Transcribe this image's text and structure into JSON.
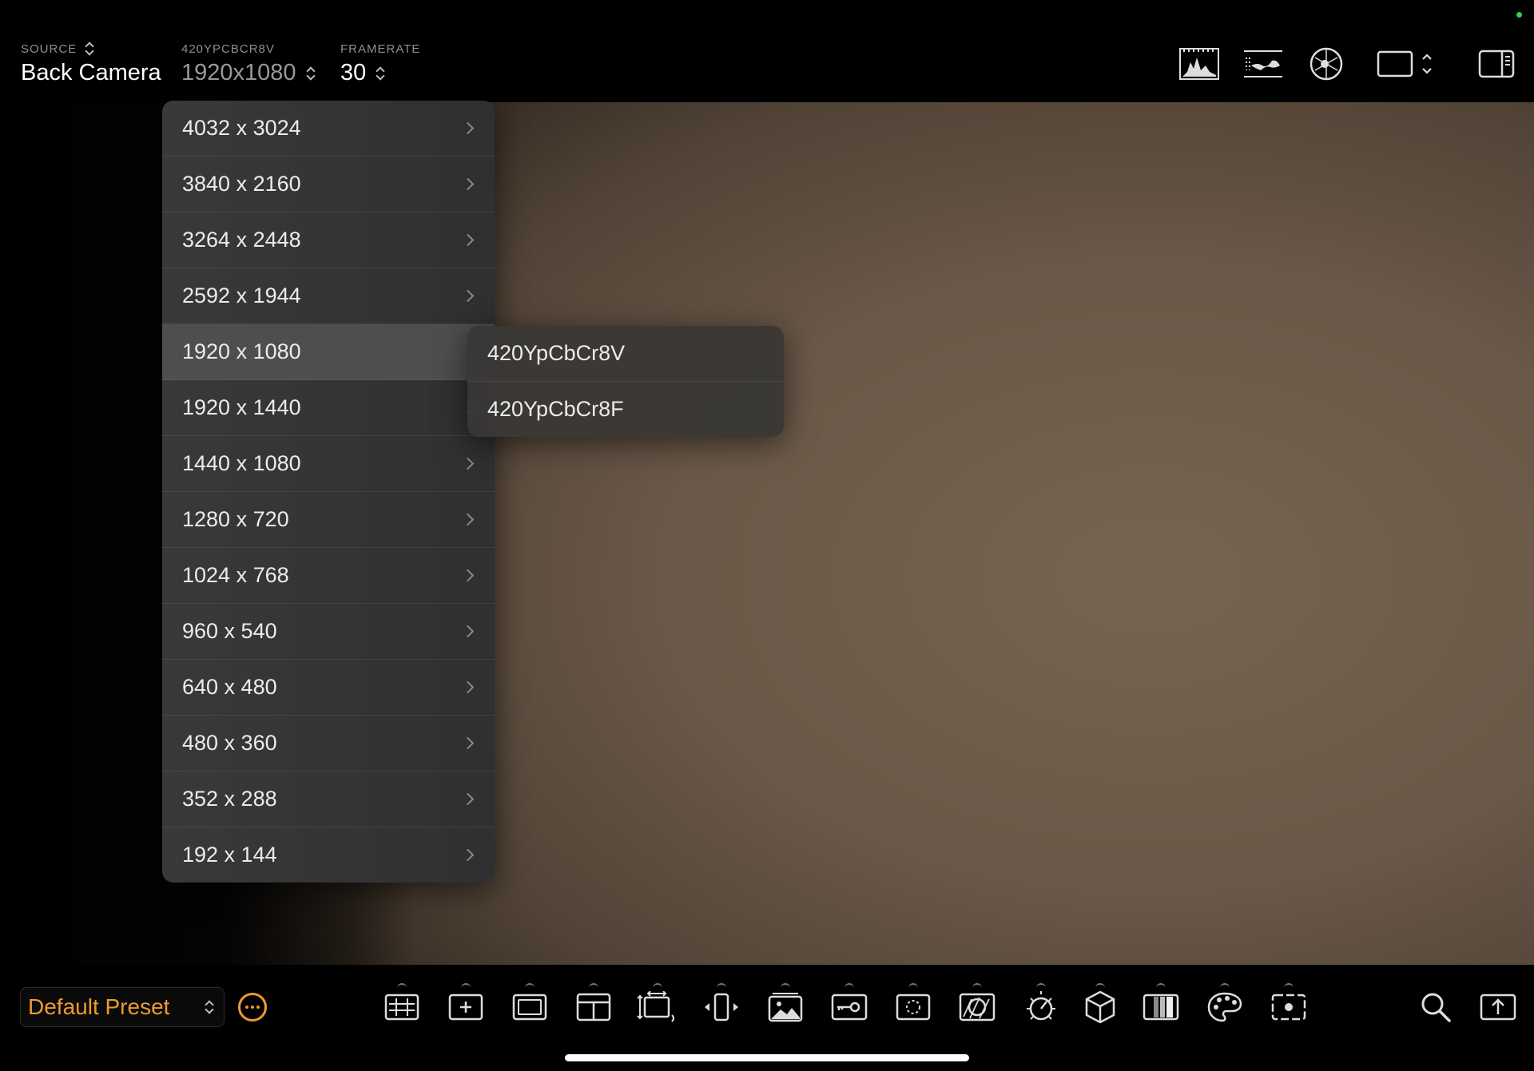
{
  "top": {
    "source_label": "SOURCE",
    "source_value": "Back Camera",
    "format_label": "420YPCBCR8V",
    "format_value": "1920x1080",
    "framerate_label": "FRAMERATE",
    "framerate_value": "30"
  },
  "resolution_menu": {
    "items": [
      {
        "label": "4032 x 3024"
      },
      {
        "label": "3840 x 2160"
      },
      {
        "label": "3264 x 2448"
      },
      {
        "label": "2592 x 1944"
      },
      {
        "label": "1920 x 1080"
      },
      {
        "label": "1920 x 1440"
      },
      {
        "label": "1440 x 1080"
      },
      {
        "label": "1280 x 720"
      },
      {
        "label": "1024 x 768"
      },
      {
        "label": "960 x 540"
      },
      {
        "label": "640 x 480"
      },
      {
        "label": "480 x 360"
      },
      {
        "label": "352 x 288"
      },
      {
        "label": "192 x 144"
      }
    ],
    "selected": "1920 x 1080"
  },
  "format_submenu": {
    "items": [
      {
        "label": "420YpCbCr8V"
      },
      {
        "label": "420YpCbCr8F"
      }
    ]
  },
  "bottom": {
    "preset_label": "Default Preset"
  },
  "colors": {
    "accent": "#f09a2e",
    "status_dot": "#2fd158"
  }
}
